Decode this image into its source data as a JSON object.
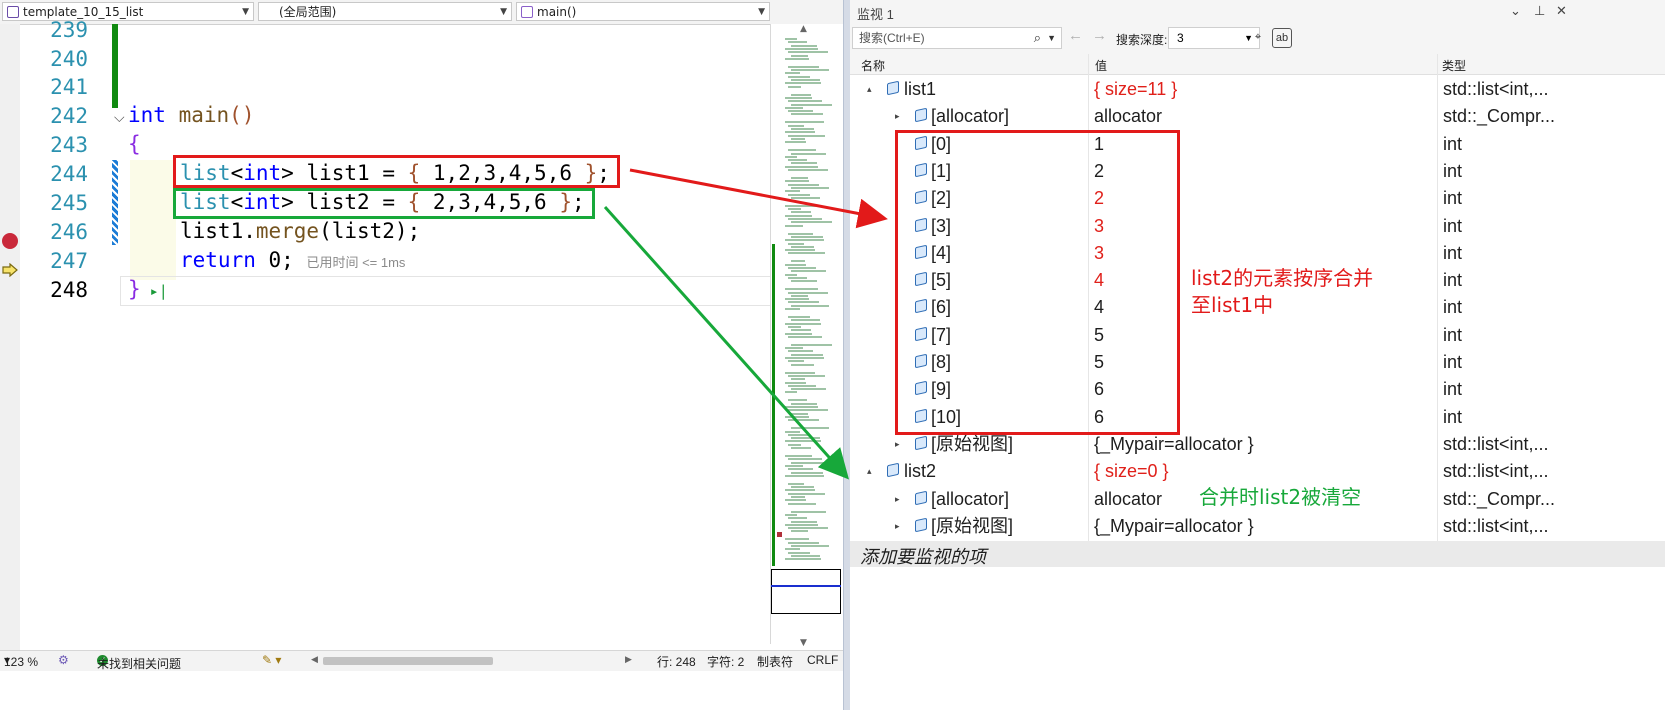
{
  "editor": {
    "file_combo": "template_10_15_list",
    "scope_combo": "(全局范围)",
    "member_combo": "main()",
    "line_numbers": [
      "239",
      "240",
      "241",
      "242",
      "243",
      "244",
      "245",
      "246",
      "247",
      "248"
    ],
    "code": {
      "l242_kw": "int",
      "l242_fn": "main",
      "l242_paren": "()",
      "l243": "{",
      "l244": [
        "list",
        "<",
        "int",
        "> list1 = ",
        "{",
        " 1,2,3,4,5,6 ",
        "}",
        ";"
      ],
      "l245": [
        "list",
        "<",
        "int",
        "> list2 = ",
        "{",
        " 2,3,4,5,6 ",
        "}",
        ";"
      ],
      "l246": [
        "list1.",
        "merge",
        "(list2);"
      ],
      "l247_kw": "return",
      "l247_rest": " 0;",
      "l247_hint": "已用时间 <= 1ms",
      "l248": "}"
    }
  },
  "statusbar": {
    "zoom": "123 %",
    "issues": "未找到相关问题",
    "line": "行: 248",
    "col": "字符: 2",
    "tabs": "制表符",
    "eol": "CRLF"
  },
  "watch": {
    "title": "监视 1",
    "search_placeholder": "搜索(Ctrl+E)",
    "depth_label": "搜索深度:",
    "depth_value": "3",
    "headers": {
      "name": "名称",
      "value": "值",
      "type": "类型"
    },
    "rows": [
      {
        "name": "list1",
        "value": "{ size=11 }",
        "type": "std::list<int,...",
        "red": true
      },
      {
        "name": "[allocator]",
        "value": "allocator",
        "type": "std::_Compr...",
        "red": false
      },
      {
        "name": "[0]",
        "value": "1",
        "type": "int",
        "red": false
      },
      {
        "name": "[1]",
        "value": "2",
        "type": "int",
        "red": false
      },
      {
        "name": "[2]",
        "value": "2",
        "type": "int",
        "red": true
      },
      {
        "name": "[3]",
        "value": "3",
        "type": "int",
        "red": true
      },
      {
        "name": "[4]",
        "value": "3",
        "type": "int",
        "red": true
      },
      {
        "name": "[5]",
        "value": "4",
        "type": "int",
        "red": true
      },
      {
        "name": "[6]",
        "value": "4",
        "type": "int",
        "red": false
      },
      {
        "name": "[7]",
        "value": "5",
        "type": "int",
        "red": false
      },
      {
        "name": "[8]",
        "value": "5",
        "type": "int",
        "red": false
      },
      {
        "name": "[9]",
        "value": "6",
        "type": "int",
        "red": false
      },
      {
        "name": "[10]",
        "value": "6",
        "type": "int",
        "red": false
      },
      {
        "name": "[原始视图]",
        "value": "{_Mypair=allocator }",
        "type": "std::list<int,...",
        "red": false
      },
      {
        "name": "list2",
        "value": "{ size=0 }",
        "type": "std::list<int,...",
        "red": true
      },
      {
        "name": "[allocator]",
        "value": "allocator",
        "type": "std::_Compr...",
        "red": false
      },
      {
        "name": "[原始视图]",
        "value": "{_Mypair=allocator }",
        "type": "std::list<int,...",
        "red": false
      }
    ],
    "add_item": "添加要监视的项"
  },
  "annotations": {
    "red_note_line1": "list2的元素按序合并",
    "red_note_line2": "至list1中",
    "green_note": "合并时list2被清空",
    "red_color": "#e21a1a",
    "green_color": "#17a83a"
  }
}
